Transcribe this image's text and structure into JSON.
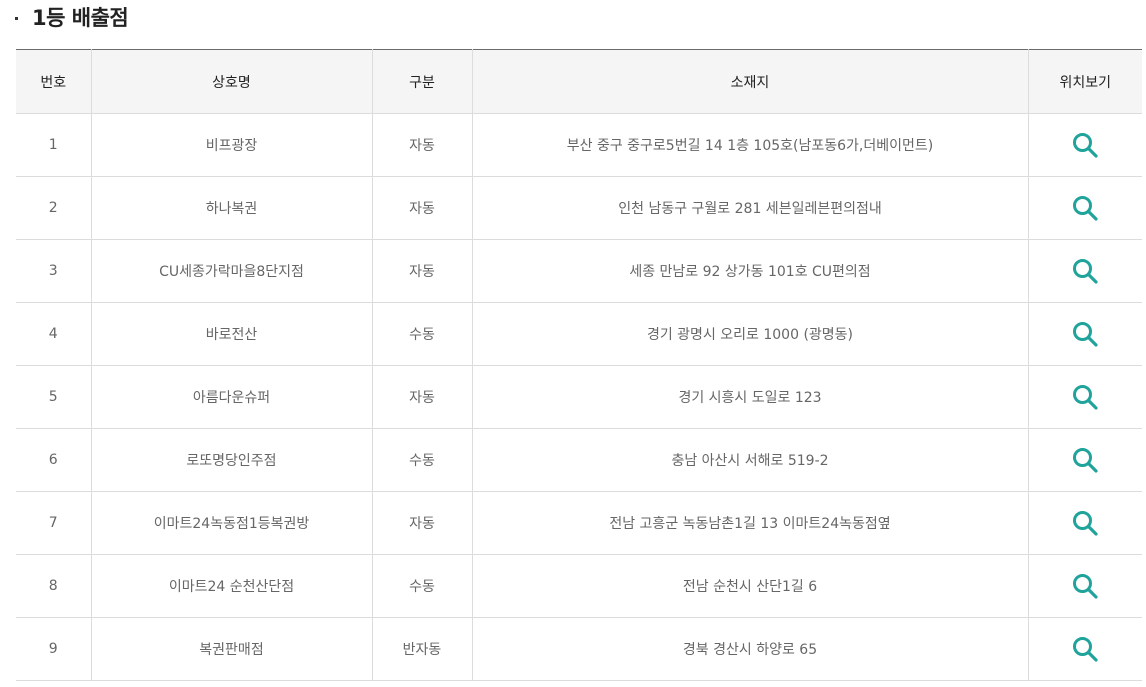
{
  "title": "1등 배출점",
  "table": {
    "headers": [
      "번호",
      "상호명",
      "구분",
      "소재지",
      "위치보기"
    ],
    "rows": [
      {
        "no": "1",
        "name": "비프광장",
        "type": "자동",
        "address": "부산 중구 중구로5번길 14 1층 105호(남포동6가,더베이먼트)"
      },
      {
        "no": "2",
        "name": "하나복권",
        "type": "자동",
        "address": "인천 남동구 구월로 281 세븐일레븐편의점내"
      },
      {
        "no": "3",
        "name": "CU세종가락마을8단지점",
        "type": "자동",
        "address": "세종 만남로 92 상가동 101호 CU편의점"
      },
      {
        "no": "4",
        "name": "바로전산",
        "type": "수동",
        "address": "경기 광명시 오리로 1000 (광명동)"
      },
      {
        "no": "5",
        "name": "아름다운슈퍼",
        "type": "자동",
        "address": "경기 시흥시 도일로 123"
      },
      {
        "no": "6",
        "name": "로또명당인주점",
        "type": "수동",
        "address": "충남 아산시 서해로 519-2"
      },
      {
        "no": "7",
        "name": "이마트24녹동점1등복권방",
        "type": "자동",
        "address": "전남 고흥군 녹동남촌1길 13 이마트24녹동점옆"
      },
      {
        "no": "8",
        "name": "이마트24 순천산단점",
        "type": "수동",
        "address": "전남 순천시 산단1길 6"
      },
      {
        "no": "9",
        "name": "복권판매점",
        "type": "반자동",
        "address": "경북 경산시 하양로 65"
      }
    ]
  },
  "icons": {
    "map_view": "search-icon"
  },
  "colors": {
    "icon": "#1fa39a",
    "header_bg": "#f5f5f5",
    "border": "#dcdcdc"
  }
}
